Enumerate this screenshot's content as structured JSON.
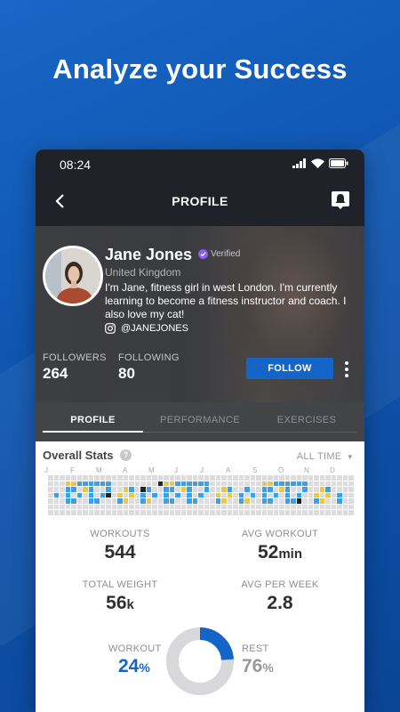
{
  "headline": "Analyze your Success",
  "status": {
    "time": "08:24"
  },
  "nav": {
    "title": "PROFILE"
  },
  "profile": {
    "name": "Jane Jones",
    "verified_label": "Verified",
    "location": "United Kingdom",
    "bio": "I'm Jane, fitness girl in west London. I'm currently learning to become a fitness instructor and coach. I also love my cat!",
    "instagram": "@JANEJONES",
    "followers_label": "FOLLOWERS",
    "followers": "264",
    "following_label": "FOLLOWING",
    "following": "80",
    "follow_button": "FOLLOW"
  },
  "tabs": [
    {
      "label": "PROFILE",
      "active": true
    },
    {
      "label": "PERFORMANCE",
      "active": false
    },
    {
      "label": "EXERCISES",
      "active": false
    }
  ],
  "overall": {
    "title": "Overall Stats",
    "help": "?",
    "range": "ALL TIME",
    "months": [
      "J",
      "F",
      "M",
      "A",
      "M",
      "J",
      "J",
      "A",
      "S",
      "O",
      "N",
      "D"
    ]
  },
  "metrics": {
    "workouts_label": "WORKOUTS",
    "workouts": "544",
    "avg_workout_label": "AVG WORKOUT",
    "avg_workout_value": "52",
    "avg_workout_unit": "min",
    "total_weight_label": "TOTAL WEIGHT",
    "total_weight_value": "56",
    "total_weight_unit": "k",
    "avg_week_label": "AVG PER WEEK",
    "avg_week": "2.8"
  },
  "split": {
    "workout_label": "WORKOUT",
    "workout_value": "24",
    "rest_label": "REST",
    "rest_value": "76",
    "unit": "%",
    "workout_fraction": 0.24,
    "workout_color": "#1565c8",
    "rest_color": "#d8d8db"
  },
  "colors": {
    "accent": "#1565c8",
    "heat_blue": "#3aa0e8",
    "heat_yellow": "#e7c84a",
    "heat_dark": "#1f2229",
    "heat_empty": "#dcdcdf"
  }
}
